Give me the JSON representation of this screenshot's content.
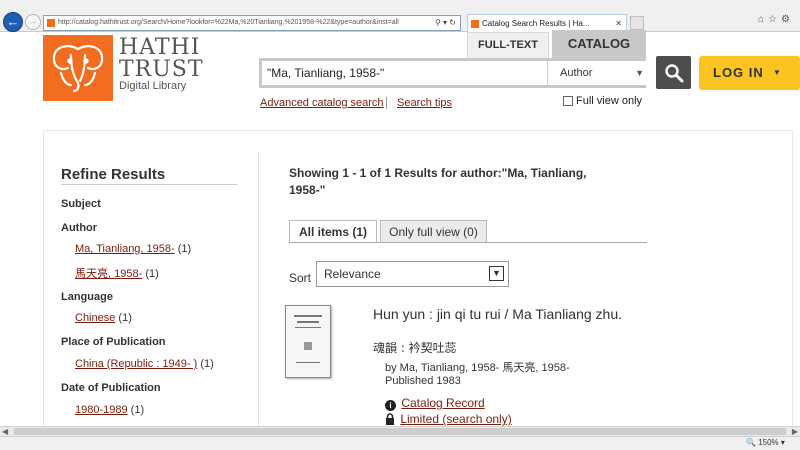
{
  "browser": {
    "url": "http://catalog.hathitrust.org/Search/Home?lookfor=%22Ma,%20Tianliang,%201958-%22&type=author&inst=all",
    "tab_title": "Catalog Search Results | Ha...",
    "zoom": "150%"
  },
  "header": {
    "logo_line1": "HATHI",
    "logo_line2": "TRUST",
    "logo_line3": "Digital Library",
    "tab_fulltext": "FULL-TEXT",
    "tab_catalog": "CATALOG",
    "search_value": "\"Ma, Tianliang, 1958-\"",
    "search_type": "Author",
    "login_label": "LOG IN",
    "advanced_link": "Advanced catalog search",
    "tips_link": "Search tips",
    "full_view_label": "Full view only"
  },
  "sidebar": {
    "title": "Refine Results",
    "subject": "Subject",
    "author": {
      "heading": "Author",
      "items": [
        {
          "label": "Ma, Tianliang, 1958-",
          "count": "(1)"
        },
        {
          "label": "馬天亮, 1958-",
          "count": "(1)"
        }
      ]
    },
    "language": {
      "heading": "Language",
      "items": [
        {
          "label": "Chinese",
          "count": "(1)"
        }
      ]
    },
    "place": {
      "heading": "Place of Publication",
      "items": [
        {
          "label": "China (Republic : 1949- )",
          "count": "(1)"
        }
      ]
    },
    "date": {
      "heading": "Date of Publication",
      "items": [
        {
          "label": "1980-1989",
          "count": "(1)"
        }
      ]
    }
  },
  "results": {
    "showing": "Showing 1 - 1 of 1 Results for author:\"Ma, Tianliang, 1958-\"",
    "tab_all": "All items (1)",
    "tab_full": "Only full view (0)",
    "sort_label": "Sort",
    "sort_value": "Relevance",
    "item": {
      "title": "Hun yun : jin qi tu rui / Ma Tianliang zhu.",
      "alt_title": "魂韻 : 衿契吐蕊",
      "author": "by Ma, Tianliang, 1958- 馬天亮, 1958-",
      "published": "Published 1983",
      "catalog_record": "Catalog Record",
      "limited": "Limited (search only)"
    }
  },
  "colors": {
    "brand_orange": "#f36d21",
    "login_yellow": "#fcc421",
    "link": "#7a1c0b"
  }
}
